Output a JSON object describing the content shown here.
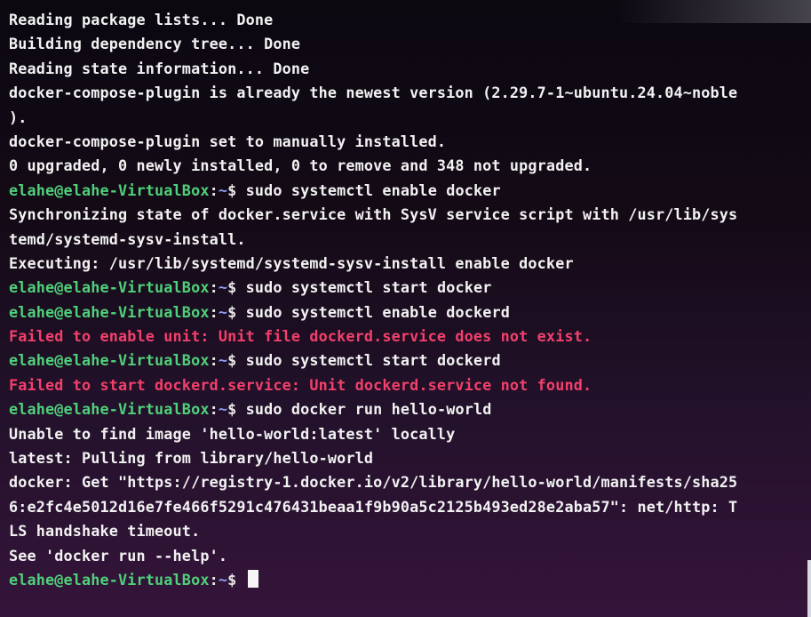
{
  "terminal": {
    "prompt": {
      "user_host": "elahe@elahe-VirtualBox",
      "colon": ":",
      "path": "~",
      "symbol": "$ "
    },
    "lines": [
      {
        "kind": "output",
        "text": "Reading package lists... Done"
      },
      {
        "kind": "output",
        "text": "Building dependency tree... Done"
      },
      {
        "kind": "output",
        "text": "Reading state information... Done"
      },
      {
        "kind": "output",
        "text": "docker-compose-plugin is already the newest version (2.29.7-1~ubuntu.24.04~noble"
      },
      {
        "kind": "output",
        "text": ")."
      },
      {
        "kind": "output",
        "text": "docker-compose-plugin set to manually installed."
      },
      {
        "kind": "output",
        "text": "0 upgraded, 0 newly installed, 0 to remove and 348 not upgraded."
      },
      {
        "kind": "prompt",
        "text": "sudo systemctl enable docker"
      },
      {
        "kind": "output",
        "text": "Synchronizing state of docker.service with SysV service script with /usr/lib/sys"
      },
      {
        "kind": "output",
        "text": "temd/systemd-sysv-install."
      },
      {
        "kind": "output",
        "text": "Executing: /usr/lib/systemd/systemd-sysv-install enable docker"
      },
      {
        "kind": "prompt",
        "text": "sudo systemctl start docker"
      },
      {
        "kind": "prompt",
        "text": "sudo systemctl enable dockerd"
      },
      {
        "kind": "error",
        "text": "Failed to enable unit: Unit file dockerd.service does not exist."
      },
      {
        "kind": "prompt",
        "text": "sudo systemctl start dockerd"
      },
      {
        "kind": "error",
        "text": "Failed to start dockerd.service: Unit dockerd.service not found."
      },
      {
        "kind": "prompt",
        "text": "sudo docker run hello-world"
      },
      {
        "kind": "output",
        "text": "Unable to find image 'hello-world:latest' locally"
      },
      {
        "kind": "output",
        "text": "latest: Pulling from library/hello-world"
      },
      {
        "kind": "output",
        "text": "docker: Get \"https://registry-1.docker.io/v2/library/hello-world/manifests/sha25"
      },
      {
        "kind": "output",
        "text": "6:e2fc4e5012d16e7fe466f5291c476431beaa1f9b90a5c2125b493ed28e2aba57\": net/http: T"
      },
      {
        "kind": "output",
        "text": "LS handshake timeout."
      },
      {
        "kind": "output",
        "text": "See 'docker run --help'."
      },
      {
        "kind": "prompt-current",
        "text": ""
      }
    ]
  },
  "colors": {
    "prompt_user": "#4fd07a",
    "prompt_path": "#8f9df5",
    "error": "#f2406b",
    "text": "#f2f2f2"
  }
}
